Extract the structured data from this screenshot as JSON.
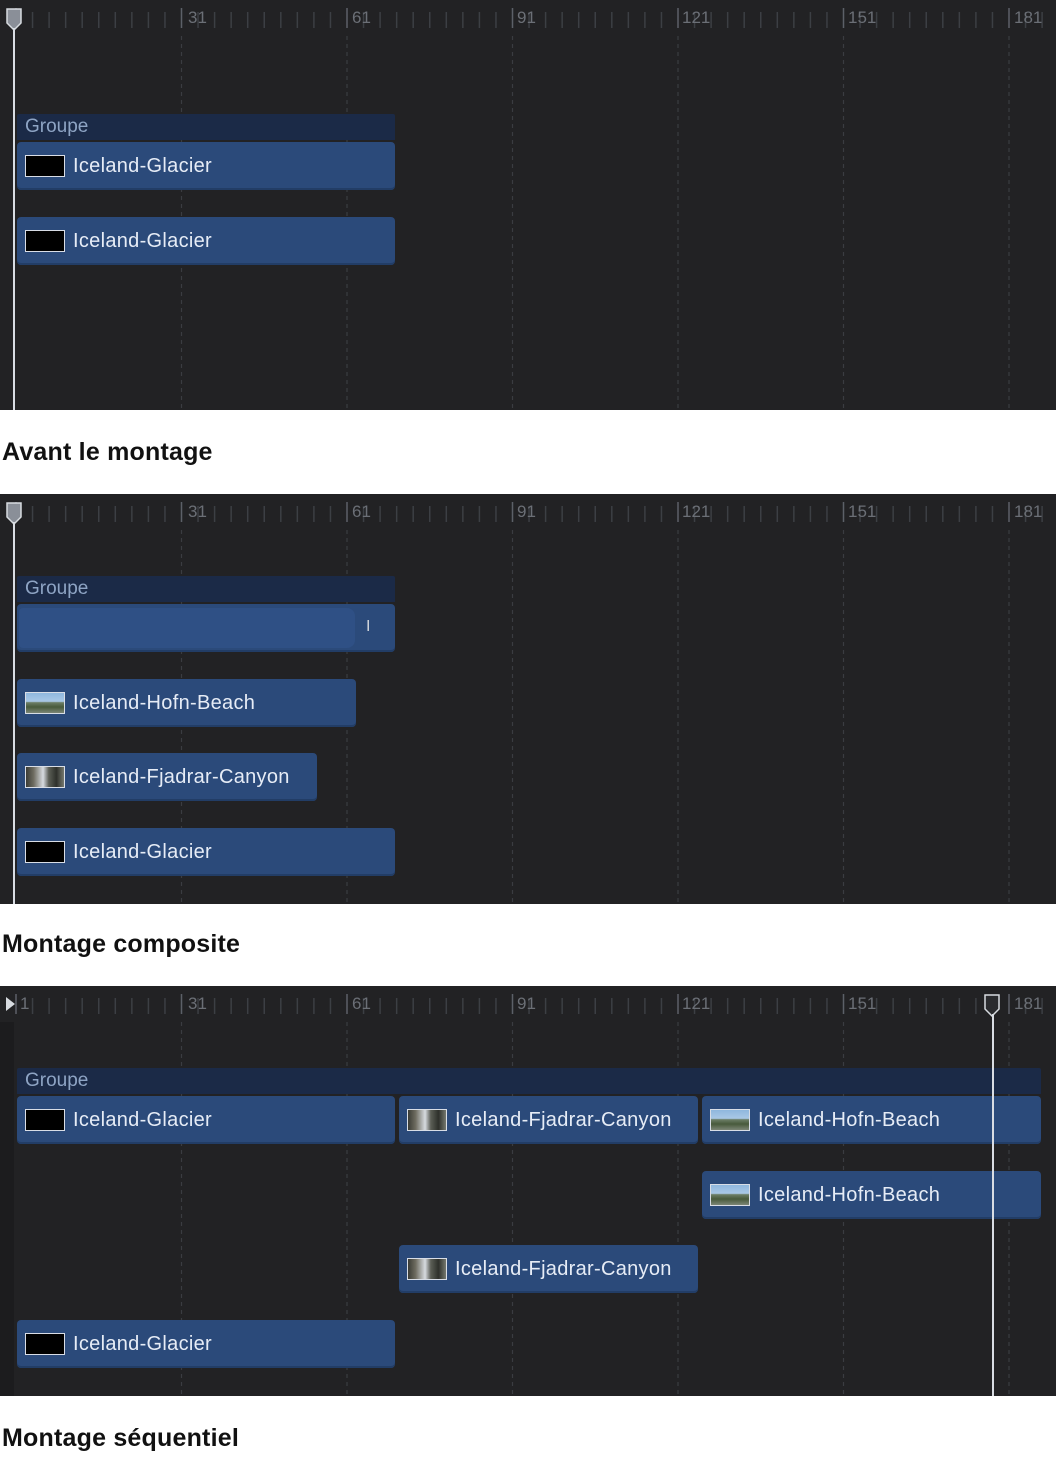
{
  "ruler": {
    "ticks": [
      "1",
      "31",
      "61",
      "91",
      "121",
      "151",
      "181"
    ]
  },
  "panels": [
    {
      "caption": "Avant le montage",
      "group_label": "Groupe",
      "clips": [
        {
          "label": "Iceland-Glacier",
          "thumb": "black-frame"
        },
        {
          "label": "Iceland-Glacier",
          "thumb": "black-frame"
        }
      ]
    },
    {
      "caption": "Montage composite",
      "group_label": "Groupe",
      "composite_marker": "I",
      "clips": [
        {
          "label": "Iceland-Hofn-Beach",
          "thumb": "beach-landscape"
        },
        {
          "label": "Iceland-Fjadrar-Canyon",
          "thumb": "canyon-landscape"
        },
        {
          "label": "Iceland-Glacier",
          "thumb": "black-frame"
        }
      ]
    },
    {
      "caption": "Montage séquentiel",
      "group_label": "Groupe",
      "group_clips": [
        {
          "label": "Iceland-Glacier",
          "thumb": "black-frame"
        },
        {
          "label": "Iceland-Fjadrar-Canyon",
          "thumb": "canyon-landscape"
        },
        {
          "label": "Iceland-Hofn-Beach",
          "thumb": "beach-landscape"
        }
      ],
      "clips": [
        {
          "label": "Iceland-Hofn-Beach",
          "thumb": "beach-landscape"
        },
        {
          "label": "Iceland-Fjadrar-Canyon",
          "thumb": "canyon-landscape"
        },
        {
          "label": "Iceland-Glacier",
          "thumb": "black-frame"
        }
      ]
    }
  ],
  "colors": {
    "track_bg": "#222224",
    "clip": "#2b4a7a",
    "group": "#1b2a47"
  }
}
